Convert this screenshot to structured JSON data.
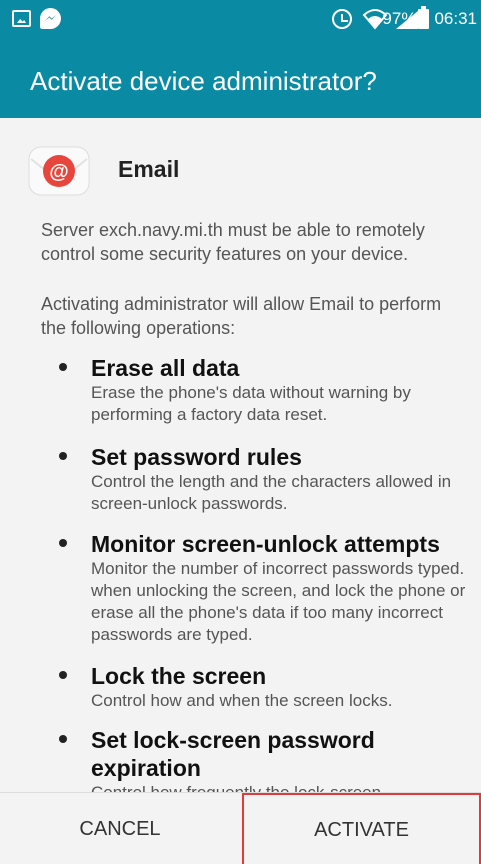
{
  "status_bar": {
    "battery_percent": "97%",
    "time": "06:31",
    "icons": [
      "gallery-icon",
      "messenger-icon",
      "alarm-icon",
      "wifi-icon",
      "signal-icon",
      "battery-icon"
    ],
    "battery_level": 0.97
  },
  "dialog": {
    "title": "Activate device administrator?",
    "app_name": "Email",
    "server_text": "Server exch.navy.mi.th must be able to remotely control some security features on your device.",
    "intro_text": "Activating administrator will allow Email to perform the following operations:",
    "operations": [
      {
        "title": "Erase all data",
        "description": "Erase the phone's data without warning by performing a factory data reset."
      },
      {
        "title": "Set password rules",
        "description": "Control the length and the characters allowed in screen-unlock passwords."
      },
      {
        "title": "Monitor screen-unlock attempts",
        "description": "Monitor the number of incorrect passwords typed. when unlocking the screen, and lock the phone or erase all the phone's data if too many incorrect passwords are typed."
      },
      {
        "title": "Lock the screen",
        "description": "Control how and when the screen locks."
      },
      {
        "title": "Set lock-screen password expiration",
        "description": "Control how frequently the lock-screen"
      }
    ]
  },
  "buttons": {
    "cancel": "CANCEL",
    "activate": "ACTIVATE"
  },
  "colors": {
    "header": "#0b8aa3",
    "highlight_border": "#e03b3b",
    "email_icon_red": "#e8453c"
  }
}
